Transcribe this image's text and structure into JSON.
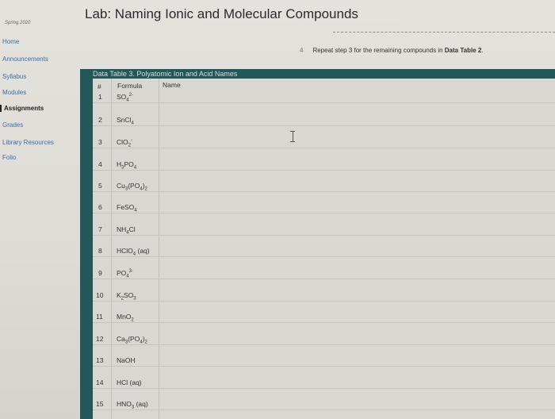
{
  "course_term": "Spring 2020",
  "page_title": "Lab: Naming Ionic and Molecular Compounds",
  "nav": [
    {
      "label": "Home",
      "active": false
    },
    {
      "label": "Announcements",
      "active": false
    },
    {
      "label": "Syllabus",
      "active": false
    },
    {
      "label": "Modules",
      "active": false
    },
    {
      "label": "Assignments",
      "active": true
    },
    {
      "label": "Grades",
      "active": false
    },
    {
      "label": "Library Resources",
      "active": false
    },
    {
      "label": "Folio",
      "active": false
    }
  ],
  "instruction": {
    "step_number": "4",
    "text_prefix": "Repeat step 3 for the remaining compounds in ",
    "text_bold": "Data Table 2",
    "text_suffix": "."
  },
  "table": {
    "caption": "Data Table 3. Polyatomic Ion and Acid Names",
    "headers": {
      "number": "#",
      "formula": "Formula",
      "name": "Name"
    },
    "rows": [
      {
        "num": "1",
        "formula": "SO<sub>4</sub><sup>2-</sup>",
        "name": ""
      },
      {
        "num": "2",
        "formula": "SnCl<sub>4</sub>",
        "name": ""
      },
      {
        "num": "3",
        "formula": "ClO<sub>2</sub><sup>-</sup>",
        "name": ""
      },
      {
        "num": "4",
        "formula": "H<sub>3</sub>PO<sub>4</sub>",
        "name": ""
      },
      {
        "num": "5",
        "formula": "Cu<sub>3</sub>(PO<sub>4</sub>)<sub>2</sub>",
        "name": ""
      },
      {
        "num": "6",
        "formula": "FeSO<sub>4</sub>",
        "name": ""
      },
      {
        "num": "7",
        "formula": "NH<sub>4</sub>Cl",
        "name": ""
      },
      {
        "num": "8",
        "formula": "HClO<sub>4</sub> (aq)",
        "name": ""
      },
      {
        "num": "9",
        "formula": "PO<sub>4</sub><sup>3-</sup>",
        "name": ""
      },
      {
        "num": "10",
        "formula": "K<sub>2</sub>SO<sub>3</sub>",
        "name": ""
      },
      {
        "num": "11",
        "formula": "MnO<sub>2</sub>",
        "name": ""
      },
      {
        "num": "12",
        "formula": "Ca<sub>3</sub>(PO<sub>4</sub>)<sub>2</sub>",
        "name": ""
      },
      {
        "num": "13",
        "formula": "NaOH",
        "name": ""
      },
      {
        "num": "14",
        "formula": "HCl (aq)",
        "name": ""
      },
      {
        "num": "15",
        "formula": "HNO<sub>3</sub> (aq)",
        "name": ""
      }
    ]
  },
  "icons": {
    "text_cursor": "i-beam-cursor-icon"
  }
}
